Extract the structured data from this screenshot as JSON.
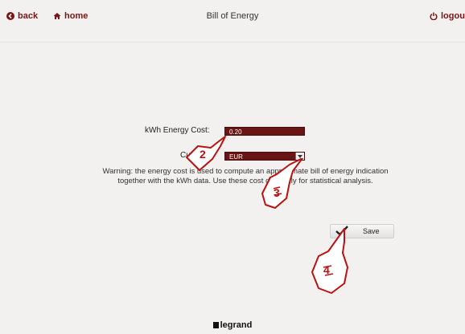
{
  "header": {
    "back_label": "back",
    "home_label": "home",
    "title": "Bill of Energy",
    "logout_label": "logout"
  },
  "form": {
    "cost_label": "kWh Energy Cost:",
    "cost_value": "0.20",
    "currency_label": "Currency:",
    "currency_value": "EUR"
  },
  "warning": "Warning: the energy cost is used to compute an approximate bill of energy indication together with the kWh data. Use these cost data only for statistical analysis.",
  "save_label": "Save",
  "footer": {
    "logo_text": "legrand"
  },
  "annotations": [
    {
      "number": "2"
    },
    {
      "number": "3"
    },
    {
      "number": "4"
    }
  ],
  "colors": {
    "accent": "#7a1414",
    "field_bg": "#6a1515",
    "background": "#f3f1ef"
  }
}
